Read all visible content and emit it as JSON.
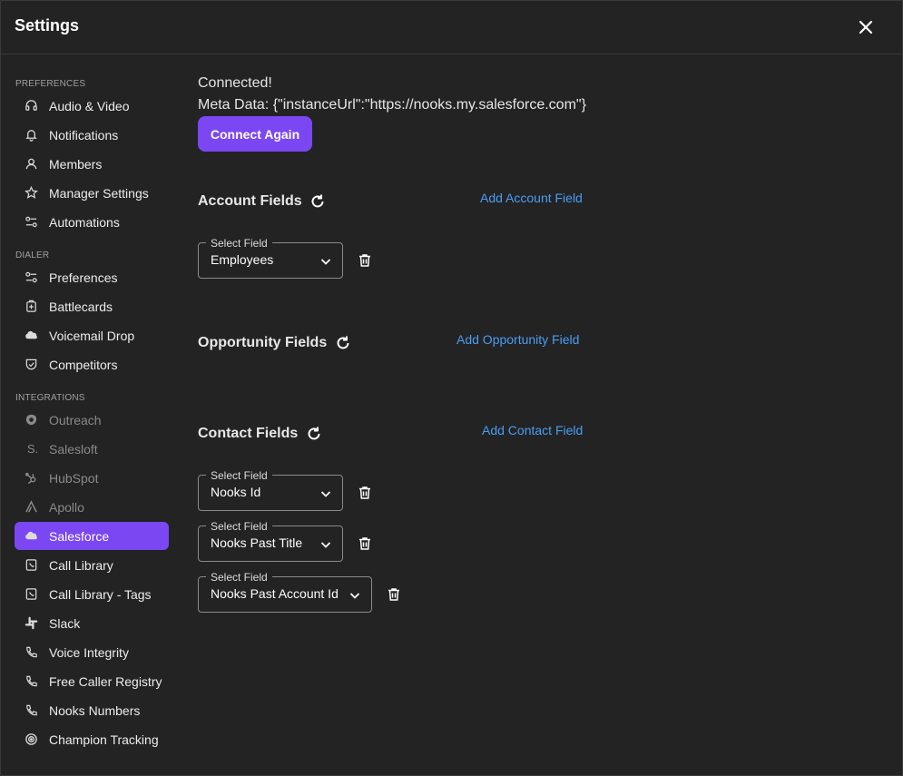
{
  "header": {
    "title": "Settings"
  },
  "sidebar": {
    "sections": {
      "preferences": "PREFERENCES",
      "dialer": "DIALER",
      "integrations": "INTEGRATIONS"
    },
    "preferences": [
      {
        "label": "Audio & Video",
        "icon": "headset-icon"
      },
      {
        "label": "Notifications",
        "icon": "bell-icon"
      },
      {
        "label": "Members",
        "icon": "user-icon"
      },
      {
        "label": "Manager Settings",
        "icon": "star-icon"
      },
      {
        "label": "Automations",
        "icon": "sliders-icon"
      }
    ],
    "dialer": [
      {
        "label": "Preferences",
        "icon": "sliders-icon"
      },
      {
        "label": "Battlecards",
        "icon": "battlecard-icon"
      },
      {
        "label": "Voicemail Drop",
        "icon": "cloud-icon"
      },
      {
        "label": "Competitors",
        "icon": "shield-check-icon"
      }
    ],
    "integrations": [
      {
        "label": "Outreach",
        "icon": "outreach-icon"
      },
      {
        "label": "Salesloft",
        "icon": "salesloft-icon"
      },
      {
        "label": "HubSpot",
        "icon": "hubspot-icon"
      },
      {
        "label": "Apollo",
        "icon": "apollo-icon"
      },
      {
        "label": "Salesforce",
        "icon": "cloud-icon"
      },
      {
        "label": "Call Library",
        "icon": "library-icon"
      },
      {
        "label": "Call Library - Tags",
        "icon": "library-icon"
      },
      {
        "label": "Slack",
        "icon": "slack-icon"
      },
      {
        "label": "Voice Integrity",
        "icon": "phone-icon"
      },
      {
        "label": "Free Caller Registry",
        "icon": "phone-icon"
      },
      {
        "label": "Nooks Numbers",
        "icon": "phone-icon"
      },
      {
        "label": "Champion Tracking",
        "icon": "target-icon"
      }
    ],
    "active_color": "#7b47f2"
  },
  "main": {
    "status": "Connected!",
    "meta": "Meta Data: {\"instanceUrl\":\"https://nooks.my.salesforce.com\"}",
    "connect_button": "Connect Again",
    "account": {
      "title": "Account Fields",
      "add_label": "Add Account Field",
      "fields": [
        {
          "legend": "Select Field",
          "value": "Employees"
        }
      ]
    },
    "opportunity": {
      "title": "Opportunity Fields",
      "add_label": "Add Opportunity Field",
      "fields": []
    },
    "contact": {
      "title": "Contact Fields",
      "add_label": "Add Contact Field",
      "fields": [
        {
          "legend": "Select Field",
          "value": "Nooks Id"
        },
        {
          "legend": "Select Field",
          "value": "Nooks Past Title"
        },
        {
          "legend": "Select Field",
          "value": "Nooks Past Account Id"
        }
      ]
    },
    "link_color": "#4a9df5"
  }
}
